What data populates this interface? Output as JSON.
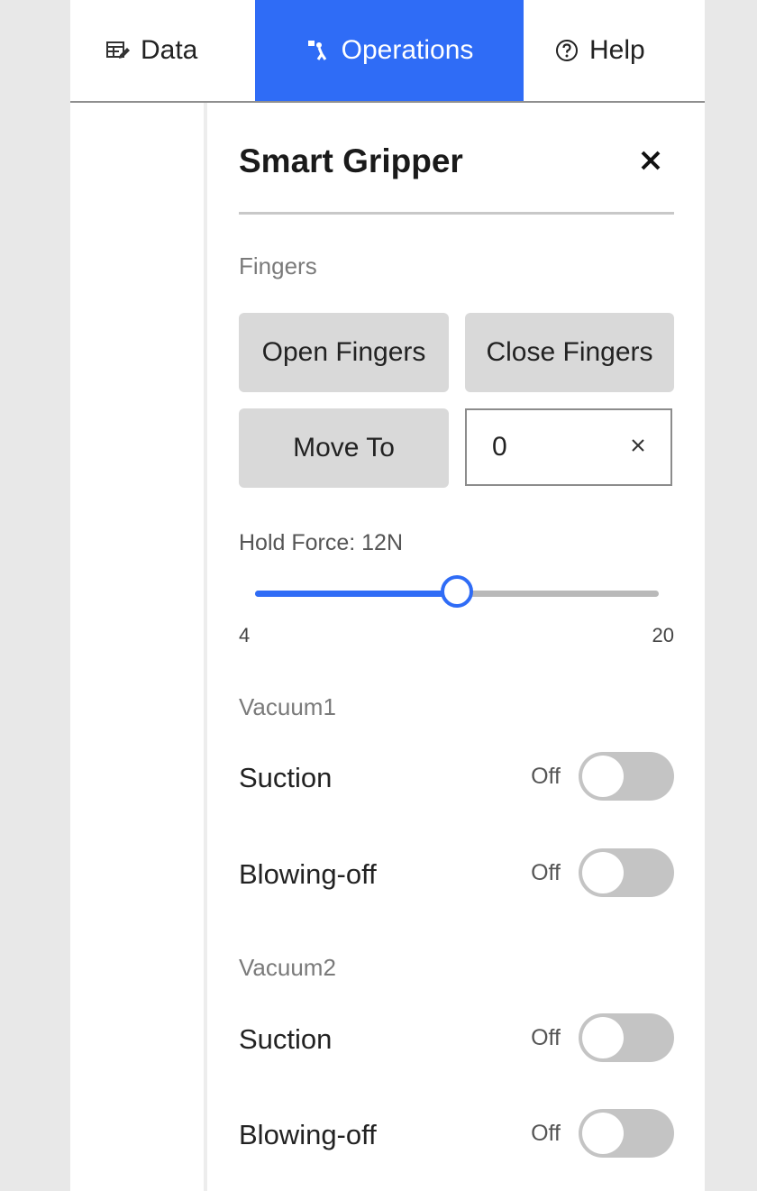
{
  "tabs": [
    {
      "label": "Data",
      "icon": "table-edit-icon"
    },
    {
      "label": "Operations",
      "icon": "robot-arm-icon",
      "active": true
    },
    {
      "label": "Help",
      "icon": "help-circle-icon"
    }
  ],
  "accent_color": "#2f6cf6",
  "panel": {
    "title": "Smart Gripper",
    "close_icon": "close-icon",
    "fingers": {
      "section_label": "Fingers",
      "open_label": "Open Fingers",
      "close_label": "Close Fingers",
      "move_to_label": "Move To",
      "move_to_value": "0"
    },
    "hold_force": {
      "label": "Hold Force: 12N",
      "min": "4",
      "max": "20",
      "value": 12
    },
    "vacuum1": {
      "section_label": "Vacuum1",
      "suction_label": "Suction",
      "suction_state": "Off",
      "blowing_label": "Blowing-off",
      "blowing_state": "Off"
    },
    "vacuum2": {
      "section_label": "Vacuum2",
      "suction_label": "Suction",
      "suction_state": "Off",
      "blowing_label": "Blowing-off",
      "blowing_state": "Off"
    }
  }
}
